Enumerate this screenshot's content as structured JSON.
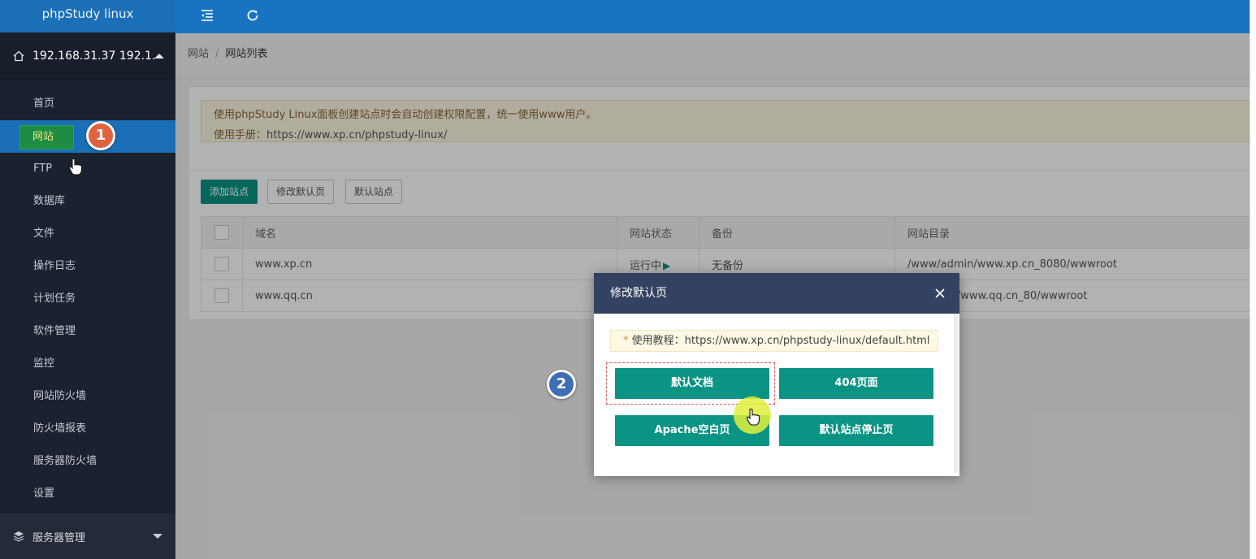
{
  "app": {
    "title": "phpStudy linux"
  },
  "sidebar": {
    "server_label": "192.168.31.37 192.1...",
    "items": [
      {
        "label": "首页"
      },
      {
        "label": "网站"
      },
      {
        "label": "FTP"
      },
      {
        "label": "数据库"
      },
      {
        "label": "文件"
      },
      {
        "label": "操作日志"
      },
      {
        "label": "计划任务"
      },
      {
        "label": "软件管理"
      },
      {
        "label": "监控"
      },
      {
        "label": "网站防火墙"
      },
      {
        "label": "防火墙报表"
      },
      {
        "label": "服务器防火墙"
      },
      {
        "label": "设置"
      }
    ],
    "bottom_group": "服务器管理"
  },
  "badges": {
    "step1": "1",
    "step2": "2"
  },
  "breadcrumb": {
    "parent": "网站",
    "separator": "/",
    "current": "网站列表"
  },
  "notice": {
    "line1": "使用phpStudy Linux面板创建站点时会自动创建权限配置，统一使用www用户。",
    "line2_prefix": "使用手册：",
    "line2_link": "https://www.xp.cn/phpstudy-linux/"
  },
  "toolbar": {
    "add_site": "添加站点",
    "edit_default": "修改默认页",
    "default_site": "默认站点"
  },
  "table": {
    "columns": [
      "域名",
      "网站状态",
      "备份",
      "网站目录"
    ],
    "rows": [
      {
        "domain": "www.xp.cn",
        "status": "运行中",
        "backup": "无备份",
        "dir": "/www/admin/www.xp.cn_8080/wwwroot"
      },
      {
        "domain": "www.qq.cn",
        "status": "",
        "backup": "",
        "dir": "in/www.qq.cn_80/wwwroot"
      }
    ]
  },
  "modal": {
    "title": "修改默认页",
    "tip_star": "*",
    "tip_text": "使用教程：https://www.xp.cn/phpstudy-linux/default.html",
    "buttons": {
      "default_doc": "默认文档",
      "page_404": "404页面",
      "apache_blank": "Apache空白页",
      "default_stop": "默认站点停止页"
    }
  },
  "colors": {
    "sidebar_bg": "#1c2130",
    "topbar_bg": "#1a73c0",
    "primary_teal": "#0b9384",
    "modal_header": "#334260",
    "badge_orange": "#e0623f",
    "badge_blue": "#3e6fb4"
  },
  "icons": {
    "home": "home-icon",
    "menu_toggle": "menu-indent-icon",
    "refresh": "refresh-icon",
    "layers": "layers-icon",
    "close": "close-icon",
    "play": "play-icon"
  }
}
